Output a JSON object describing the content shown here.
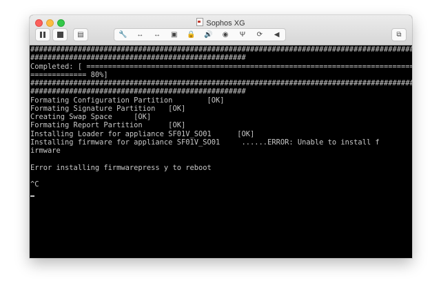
{
  "window": {
    "title": "Sophos XG"
  },
  "toolbar": {
    "pause": "pause-icon",
    "stop": "stop-icon",
    "settings": "vm-settings-icon",
    "group": [
      {
        "name": "wrench-icon",
        "glyph": "🔧"
      },
      {
        "name": "network-arrows-icon",
        "glyph": "↔"
      },
      {
        "name": "network-arrows-2-icon",
        "glyph": "↔"
      },
      {
        "name": "disk-icon",
        "glyph": "▣"
      },
      {
        "name": "lock-icon",
        "glyph": "🔒"
      },
      {
        "name": "speaker-icon",
        "glyph": "🔊"
      },
      {
        "name": "camera-icon",
        "glyph": "◉"
      },
      {
        "name": "usb-icon",
        "glyph": "Ψ"
      },
      {
        "name": "sync-icon",
        "glyph": "⟳"
      },
      {
        "name": "chevron-left-icon",
        "glyph": "◀"
      }
    ],
    "fullscreen": "fullscreen-icon"
  },
  "console": {
    "lines": [
      "##########################################################################################",
      "##################################################",
      "Completed: [ =============================================================================",
      "============= 80%]",
      "##########################################################################################",
      "##################################################",
      "Formating Configuration Partition        [OK]",
      "Formating Signature Partition   [OK]",
      "Creating Swap Space     [OK]",
      "Formating Report Partition      [OK]",
      "Installing Loader for appliance SF01V_SO01      [OK]",
      "Installing firmware for appliance SF01V_SO01     ......ERROR: Unable to install f",
      "irmware",
      "",
      "Error installing firmwarepress y to reboot",
      "",
      "^C"
    ]
  }
}
